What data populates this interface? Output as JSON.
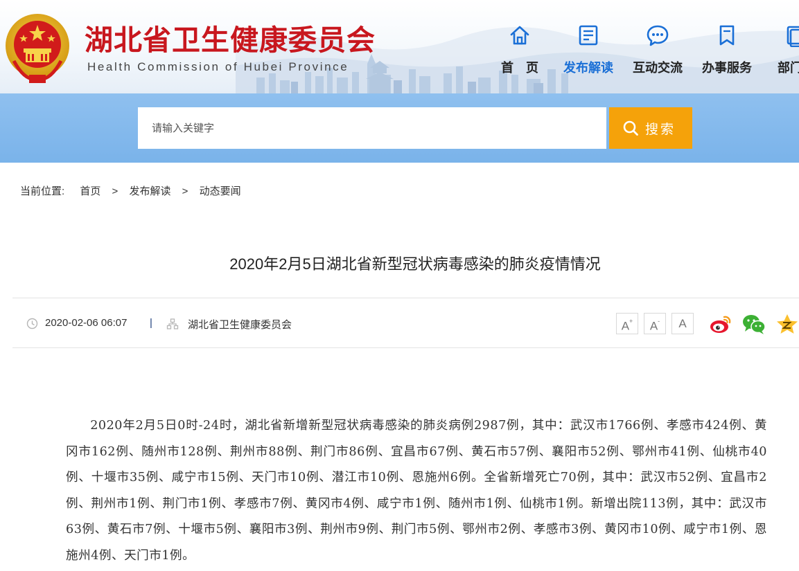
{
  "header": {
    "site_title": "湖北省卫生健康委员会",
    "site_subtitle": "Health Commission of Hubei Province",
    "colors": {
      "title_red": "#c8171e",
      "accent_blue": "#1a6fd6",
      "search_orange": "#f5a20a"
    }
  },
  "nav": {
    "items": [
      {
        "label": "首　页",
        "icon": "home-icon",
        "active": false
      },
      {
        "label": "发布解读",
        "icon": "document-icon",
        "active": true
      },
      {
        "label": "互动交流",
        "icon": "chat-icon",
        "active": false
      },
      {
        "label": "办事服务",
        "icon": "bookmark-icon",
        "active": false
      },
      {
        "label": "部门动",
        "icon": "department-icon",
        "active": false
      }
    ]
  },
  "search": {
    "placeholder": "请输入关键字",
    "button_label": "搜索"
  },
  "breadcrumb": {
    "prefix": "当前位置:",
    "items": [
      "首页",
      "发布解读",
      "动态要闻"
    ],
    "separator": ">"
  },
  "article": {
    "title": "2020年2月5日湖北省新型冠状病毒感染的肺炎疫情情况",
    "date": "2020-02-06 06:07",
    "divider": "|",
    "source": "湖北省卫生健康委员会",
    "font_controls": {
      "increase": "A",
      "increase_mark": "+",
      "decrease": "A",
      "decrease_mark": "-",
      "reset": "A"
    },
    "body": "2020年2月5日0时-24时，湖北省新增新型冠状病毒感染的肺炎病例2987例，其中：武汉市1766例、孝感市424例、黄冈市162例、随州市128例、荆州市88例、荆门市86例、宜昌市67例、黄石市57例、襄阳市52例、鄂州市41例、仙桃市40例、十堰市35例、咸宁市15例、天门市10例、潜江市10例、恩施州6例。全省新增死亡70例，其中：武汉市52例、宜昌市2例、荆州市1例、荆门市1例、孝感市7例、黄冈市4例、咸宁市1例、随州市1例、仙桃市1例。新增出院113例，其中：武汉市63例、黄石市7例、十堰市5例、襄阳市3例、荆州市9例、荆门市5例、鄂州市2例、孝感市3例、黄冈市10例、咸宁市1例、恩施州4例、天门市1例。"
  }
}
